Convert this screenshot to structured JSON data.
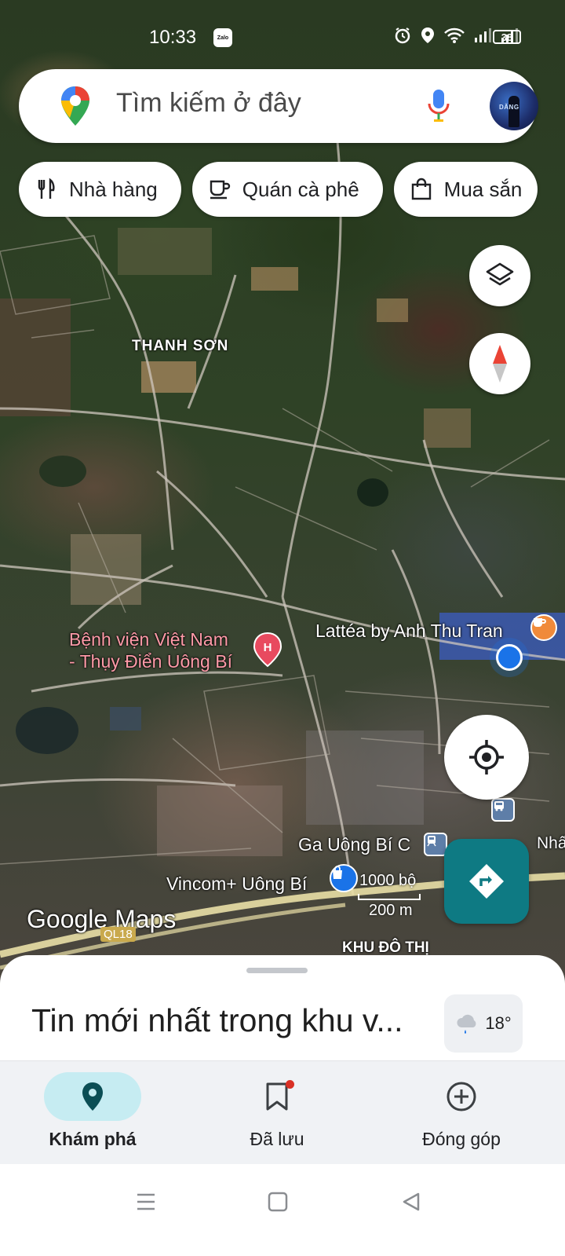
{
  "status_bar": {
    "time": "10:33",
    "notification_app": "Zalo",
    "battery": "38",
    "icons": [
      "alarm-icon",
      "location-icon",
      "wifi-icon",
      "signal-icon",
      "signal-icon"
    ]
  },
  "search": {
    "placeholder": "Tìm kiếm ở đây"
  },
  "avatar": {
    "text": "DĂNG"
  },
  "chips": [
    {
      "label": "Nhà hàng",
      "icon": "restaurant-icon"
    },
    {
      "label": "Quán cà phê",
      "icon": "coffee-icon"
    },
    {
      "label": "Mua sắn",
      "icon": "shopping-bag-icon"
    }
  ],
  "map": {
    "labels": {
      "thanh_son": "THANH SƠN",
      "hospital_line1": "Bệnh viện Việt Nam",
      "hospital_line2": "- Thụy Điển Uông Bí",
      "lattea": "Lattéa by Anh Thu Tran",
      "ga": "Ga Uông Bí C",
      "nhat": "Nhấ",
      "vincom": "Vincom+ Uông Bí",
      "khu_do_thi": "KHU ĐÔ THỊ",
      "road_ql": "QL18",
      "hospital_marker": "H"
    },
    "scale": {
      "imperial": "1000 bộ",
      "metric": "200 m"
    },
    "brand": "Google Maps"
  },
  "sheet": {
    "title": "Tin mới nhất trong khu v...",
    "weather_temp": "18°"
  },
  "bottom_nav": [
    {
      "label": "Khám phá",
      "icon": "explore-pin-icon",
      "active": true
    },
    {
      "label": "Đã lưu",
      "icon": "bookmark-icon",
      "active": false
    },
    {
      "label": "Đóng góp",
      "icon": "add-circle-icon",
      "active": false
    }
  ],
  "colors": {
    "accent_teal": "#0e7a83",
    "active_pill": "#c6ecf2",
    "hospital_red": "#e84a5f",
    "location_blue": "#1a73e8"
  }
}
